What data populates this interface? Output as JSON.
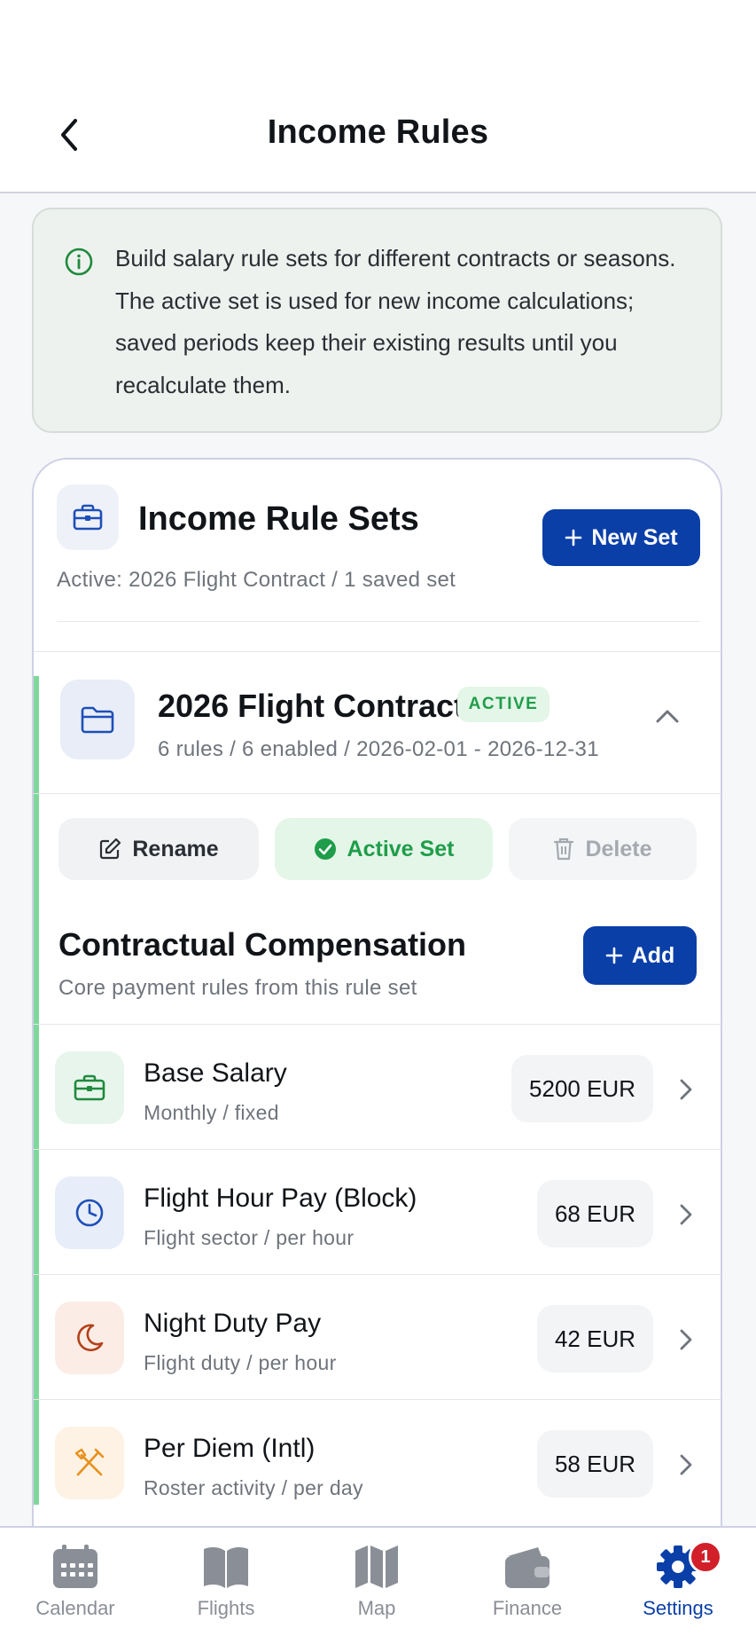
{
  "header": {
    "title": "Income Rules"
  },
  "info": {
    "text": "Build salary rule sets for different contracts or seasons. The active set is used for new income calculations; saved periods keep their existing results until you recalculate them."
  },
  "rule_sets": {
    "title": "Income Rule Sets",
    "subtitle": "Active: 2026 Flight Contract / 1 saved set",
    "new_set_label": "New Set"
  },
  "current_set": {
    "name": "2026 Flight Contract",
    "badge": "ACTIVE",
    "meta": "6 rules / 6 enabled / 2026-02-01 - 2026-12-31",
    "actions": {
      "rename": "Rename",
      "active": "Active Set",
      "delete": "Delete"
    }
  },
  "compensation": {
    "title": "Contractual Compensation",
    "subtitle": "Core payment rules from this rule set",
    "add_label": "Add"
  },
  "rules": [
    {
      "name": "Base Salary",
      "desc": "Monthly / fixed",
      "amount": "5200 EUR",
      "icon": "briefcase-icon",
      "color": "#1f8a3d",
      "bg": "#e8f5ec"
    },
    {
      "name": "Flight Hour Pay (Block)",
      "desc": "Flight sector / per hour",
      "amount": "68 EUR",
      "icon": "clock-icon",
      "color": "#1e4fb8",
      "bg": "#e8eef9"
    },
    {
      "name": "Night Duty Pay",
      "desc": "Flight duty / per hour",
      "amount": "42 EUR",
      "icon": "moon-icon",
      "color": "#b2421a",
      "bg": "#fbece6"
    },
    {
      "name": "Per Diem (Intl)",
      "desc": "Roster activity / per day",
      "amount": "58 EUR",
      "icon": "fork-knife-icon",
      "color": "#e8901a",
      "bg": "#fdf2e4"
    }
  ],
  "tabs": [
    {
      "label": "Calendar",
      "icon": "calendar-icon",
      "active": false
    },
    {
      "label": "Flights",
      "icon": "book-icon",
      "active": false
    },
    {
      "label": "Map",
      "icon": "map-icon",
      "active": false
    },
    {
      "label": "Finance",
      "icon": "wallet-icon",
      "active": false
    },
    {
      "label": "Settings",
      "icon": "gear-icon",
      "active": true,
      "badge": "1"
    }
  ],
  "colors": {
    "primary": "#0a3fa8",
    "active_green": "#1f9d4a",
    "accent_bar": "#7ed89a",
    "badge_red": "#d2202a"
  }
}
